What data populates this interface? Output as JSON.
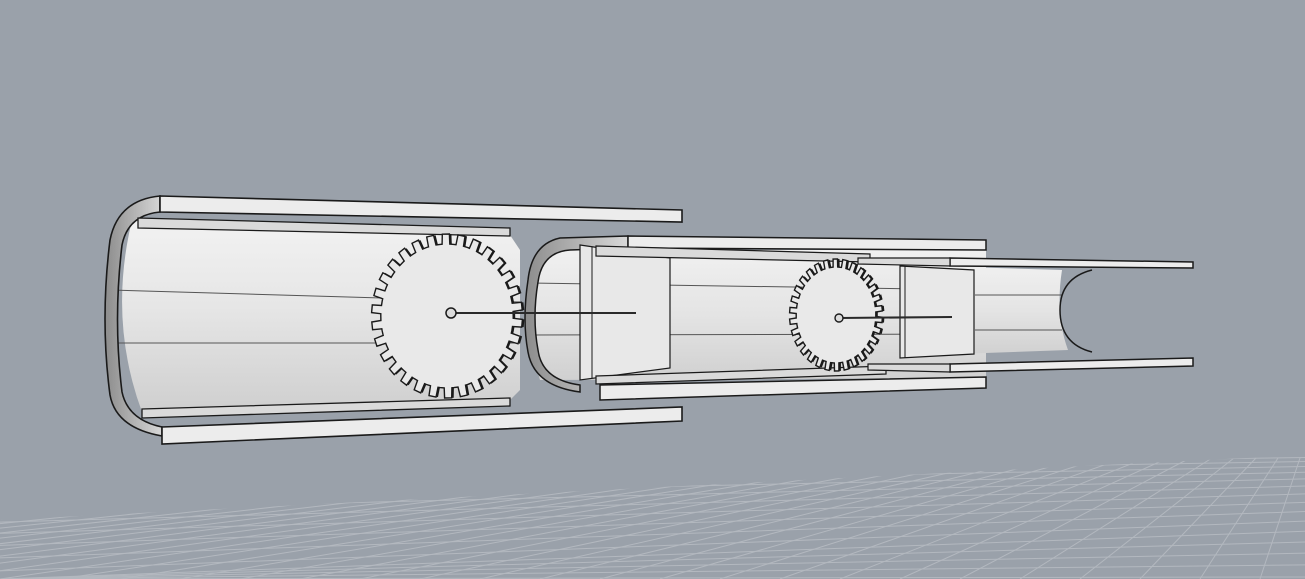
{
  "viewport": {
    "kind": "3d-modeling-perspective-viewport",
    "display_mode": "shaded",
    "background_color": "#9aa1aa",
    "grid_visible": true,
    "grid_color": "#b3b8bf",
    "model_fill_color": "#e3e3e3",
    "model_outline_color": "#1a1a1a"
  },
  "model": {
    "name": "telescoping-channel-assembly",
    "parts": [
      {
        "name": "large-channel-tube",
        "gear": "large-gear",
        "gear_teeth": 30
      },
      {
        "name": "medium-channel-tube",
        "gear": "small-gear",
        "gear_teeth": 30
      },
      {
        "name": "small-channel-tube"
      }
    ]
  }
}
